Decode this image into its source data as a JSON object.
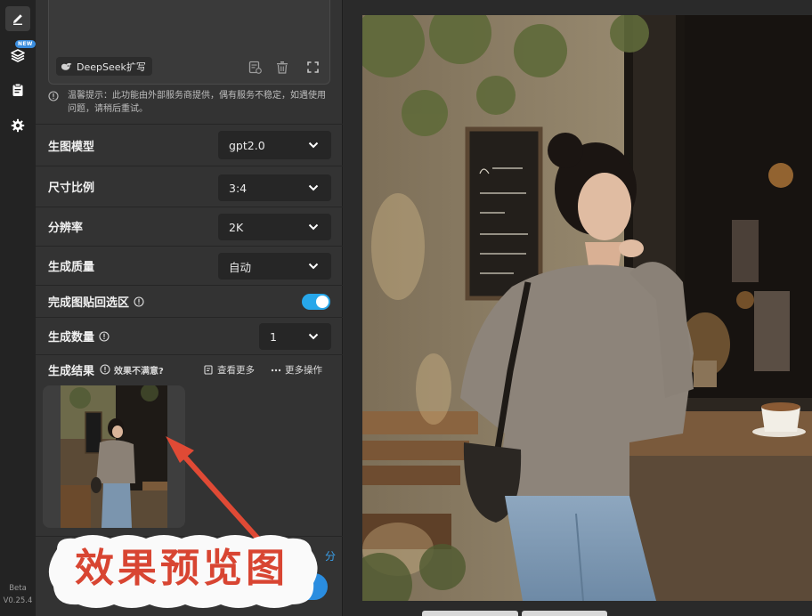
{
  "sidebar": {
    "new_badge": "NEW",
    "version_line1": "Beta",
    "version_line2": "V0.25.4"
  },
  "prompt": {
    "deepseek_label": "DeepSeek扩写",
    "tip": "温馨提示：此功能由外部服务商提供，偶有服务不稳定，如遇使用问题，请稍后重试。"
  },
  "settings": {
    "model_label": "生图模型",
    "model_value": "gpt2.0",
    "ratio_label": "尺寸比例",
    "ratio_value": "3:4",
    "resolution_label": "分辨率",
    "resolution_value": "2K",
    "quality_label": "生成质量",
    "quality_value": "自动",
    "paste_back_label": "完成图贴回选区",
    "paste_back_on": true,
    "count_label": "生成数量",
    "count_value": "1"
  },
  "result": {
    "title": "生成结果",
    "unsatisfied": "效果不满意?",
    "view_more": "查看更多",
    "more_actions": "更多操作"
  },
  "generate": {
    "partial_text": "分"
  },
  "annotation": {
    "text": "效果预览图",
    "arrow_color": "#e04a35"
  },
  "colors": {
    "accent": "#27a7ea",
    "panel": "#333333",
    "annotation": "#d84532"
  }
}
